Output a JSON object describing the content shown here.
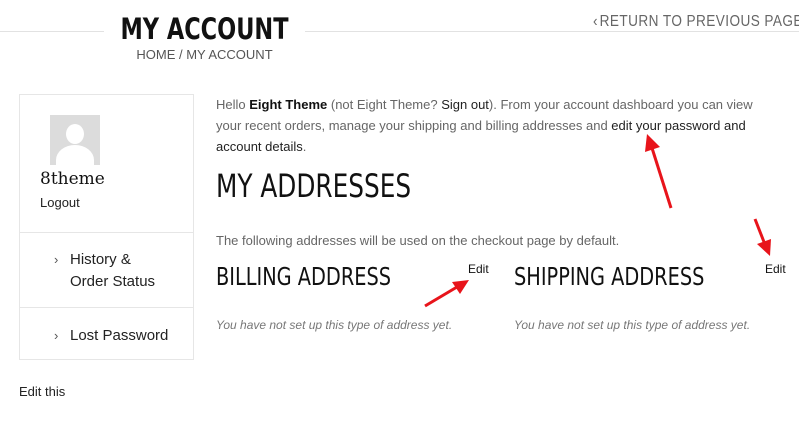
{
  "header": {
    "title": "MY ACCOUNT",
    "breadcrumb": "HOME / MY ACCOUNT",
    "return_link": "RETURN TO PREVIOUS PAGE"
  },
  "sidebar": {
    "username": "8theme",
    "logout": "Logout",
    "items": [
      {
        "label_line1": "History &",
        "label_line2": "Order Status"
      },
      {
        "label_line1": "Lost Password"
      }
    ],
    "edit_this": "Edit this"
  },
  "main": {
    "intro": {
      "hello": "Hello ",
      "user": "Eight Theme",
      "not_user_pre": " (not Eight Theme? ",
      "sign_out": "Sign out",
      "rest": "). From your account dashboard you can view your recent orders, manage your shipping and billing addresses and ",
      "edit_link": "edit your password and account details",
      "end": "."
    },
    "heading": "MY ADDRESSES",
    "note": "The following addresses will be used on the checkout page by default.",
    "billing": {
      "title": "BILLING ADDRESS",
      "edit": "Edit",
      "empty": "You have not set up this type of address yet."
    },
    "shipping": {
      "title": "SHIPPING ADDRESS",
      "edit": "Edit",
      "empty": "You have not set up this type of address yet."
    }
  },
  "colors": {
    "annotation_arrow": "#e8141b",
    "divider": "#e2e2e2",
    "avatar_bg": "#dcdcdc"
  },
  "icons": [
    "chevron-left-icon",
    "avatar-placeholder-icon",
    "chevron-right-icon",
    "annotation-arrow-icon"
  ]
}
